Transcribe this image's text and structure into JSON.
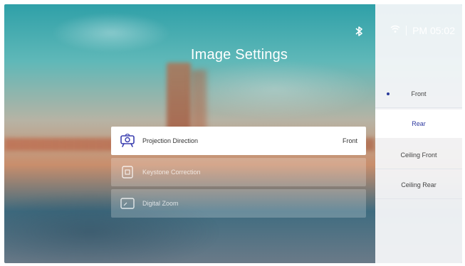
{
  "title": "Image Settings",
  "status_bar": {
    "bluetooth_icon": "bluetooth-icon",
    "wifi_icon": "wifi-icon",
    "time": "PM 05:02"
  },
  "menu": [
    {
      "icon": "projector-icon",
      "label": "Projection Direction",
      "value": "Front",
      "selected": true
    },
    {
      "icon": "keystone-icon",
      "label": "Keystone Correction",
      "value": "",
      "selected": false
    },
    {
      "icon": "zoom-icon",
      "label": "Digital Zoom",
      "value": "",
      "selected": false
    }
  ],
  "options_panel": {
    "options": [
      {
        "label": "Front",
        "checked": true,
        "focused": false
      },
      {
        "label": "Rear",
        "checked": false,
        "focused": true
      },
      {
        "label": "Ceiling Front",
        "checked": false,
        "focused": false
      },
      {
        "label": "Ceiling Rear",
        "checked": false,
        "focused": false
      }
    ],
    "accent_color": "#2f3aa0"
  }
}
